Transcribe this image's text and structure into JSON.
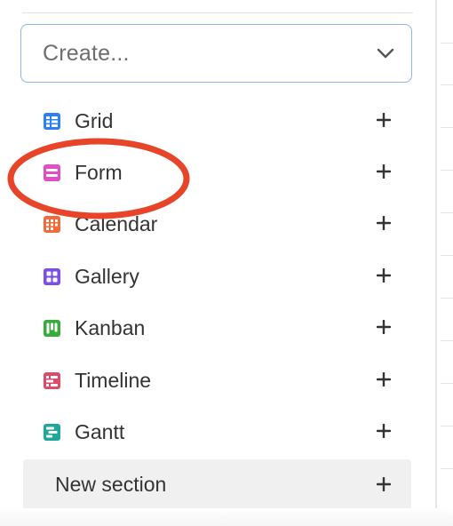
{
  "create": {
    "placeholder": "Create..."
  },
  "views": [
    {
      "label": "Grid",
      "icon": "grid-icon",
      "color": "#2d7ff9"
    },
    {
      "label": "Form",
      "icon": "form-icon",
      "color": "#e04fc8"
    },
    {
      "label": "Calendar",
      "icon": "calendar-icon",
      "color": "#f26b3a"
    },
    {
      "label": "Gallery",
      "icon": "gallery-icon",
      "color": "#7c4ee4"
    },
    {
      "label": "Kanban",
      "icon": "kanban-icon",
      "color": "#3aab3a"
    },
    {
      "label": "Timeline",
      "icon": "timeline-icon",
      "color": "#e04a6a"
    },
    {
      "label": "Gantt",
      "icon": "gantt-icon",
      "color": "#1fa898"
    }
  ],
  "new_section": {
    "label": "New section"
  },
  "annotation": {
    "color": "#e8442a",
    "target": "Form"
  }
}
